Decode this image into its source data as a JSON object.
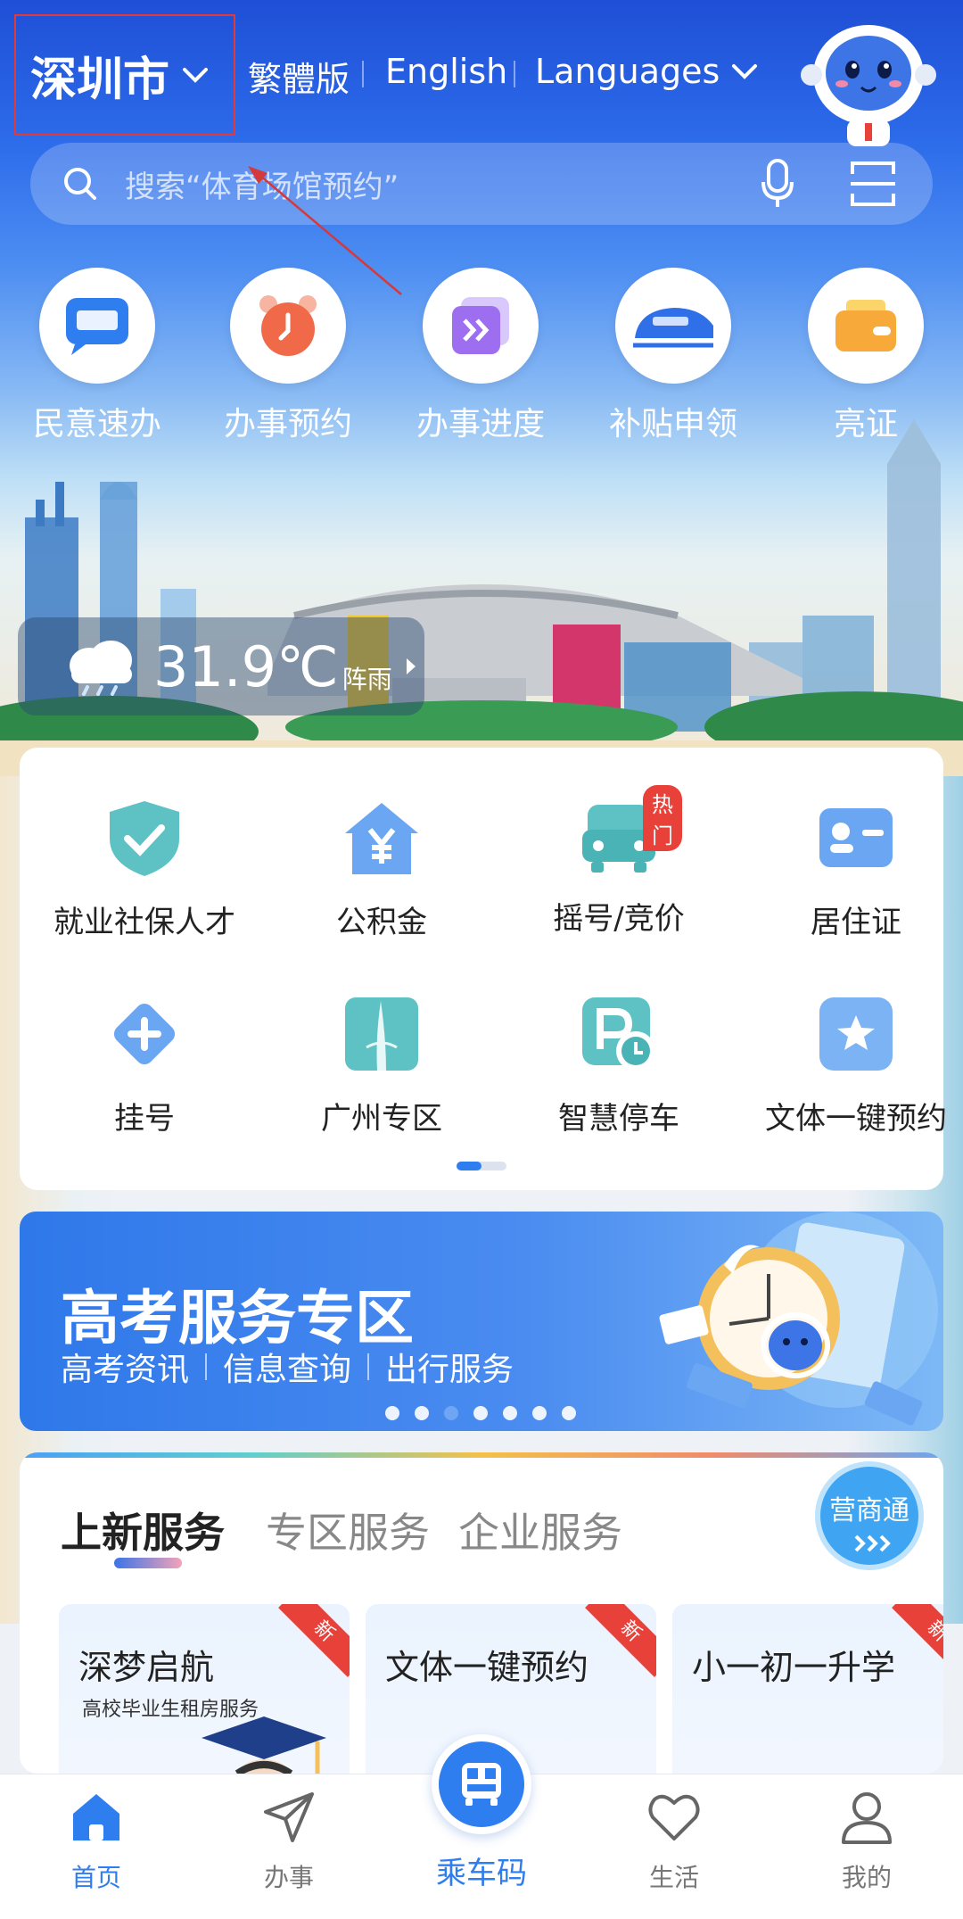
{
  "header": {
    "city": "深圳市",
    "languages": [
      "繁體版",
      "English",
      "Languages"
    ]
  },
  "search": {
    "placeholder": "搜索“体育场馆预约”"
  },
  "quick_actions": [
    {
      "label": "民意速办",
      "icon": "feedback-chat-icon"
    },
    {
      "label": "办事预约",
      "icon": "alarm-clock-icon"
    },
    {
      "label": "办事进度",
      "icon": "progress-forward-icon"
    },
    {
      "label": "补贴申领",
      "icon": "train-icon"
    },
    {
      "label": "亮证",
      "icon": "wallet-card-icon"
    }
  ],
  "weather": {
    "temperature": "31.9℃",
    "condition": "阵雨",
    "icon": "cloud-rain-icon"
  },
  "services_grid": {
    "items": [
      {
        "label": "就业社保人才",
        "icon": "shield-check-icon"
      },
      {
        "label": "公积金",
        "icon": "house-yuan-icon"
      },
      {
        "label": "摇号/竞价",
        "icon": "car-icon",
        "badge": "热门"
      },
      {
        "label": "居住证",
        "icon": "id-card-icon"
      },
      {
        "label": "挂号",
        "icon": "medical-cross-icon"
      },
      {
        "label": "广州专区",
        "icon": "canton-tower-icon"
      },
      {
        "label": "智慧停车",
        "icon": "parking-clock-icon"
      },
      {
        "label": "文体一键预约",
        "icon": "star-ticket-icon"
      }
    ],
    "page": 1,
    "page_count": 2
  },
  "banner": {
    "title": "高考服务专区",
    "subtitles": [
      "高考资讯",
      "信息查询",
      "出行服务"
    ],
    "dot_count": 7,
    "active_dot": 3
  },
  "new_services": {
    "tabs": [
      "上新服务",
      "专区服务",
      "企业服务"
    ],
    "active_tab": 0,
    "shortcut_label": "营商通",
    "cards": [
      {
        "title": "深梦启航",
        "subtitle": "高校毕业生租房服务",
        "tag": "新"
      },
      {
        "title": "文体一键预约",
        "subtitle": "",
        "tag": "新"
      },
      {
        "title": "小一初一升学",
        "subtitle": "",
        "tag": "新"
      }
    ]
  },
  "bottom_nav": {
    "items": [
      {
        "label": "首页",
        "icon": "home-icon",
        "active": true
      },
      {
        "label": "办事",
        "icon": "send-arrow-icon",
        "active": false
      },
      {
        "label": "乘车码",
        "icon": "bus-qr-icon",
        "active": false
      },
      {
        "label": "生活",
        "icon": "heart-icon",
        "active": false
      },
      {
        "label": "我的",
        "icon": "user-icon",
        "active": false
      }
    ]
  },
  "colors": {
    "accent": "#2f7ef0",
    "badge_red": "#e8413a",
    "annotation_red": "#e23a3a"
  }
}
